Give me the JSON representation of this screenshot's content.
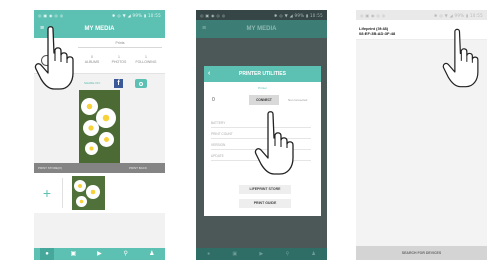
{
  "panel1": {
    "status_left": "◎ ▣ ◉ ◎ ◎",
    "status_right": "✱ ◎ ▼ ◢ 99% ▮ 10:55",
    "title": "MY MEDIA",
    "tab_label": "Prints",
    "stats": [
      "0\nALBUMS",
      "1\nPHOTOS",
      "1\nFOLLOWING"
    ],
    "social_label": "SHARE ON:",
    "print_labels": [
      "PRINT STORE(X)",
      "PRINT BACK"
    ],
    "add_label": "+",
    "nav_icons": [
      "camera-icon",
      "gallery-icon",
      "video-icon",
      "search-icon",
      "person-icon"
    ]
  },
  "panel2": {
    "status_left": "◎ ▣ ◉ ◎ ◎",
    "status_right": "✱ ◎ ▼ ◢ 99% ▮ 10:55",
    "title": "MY MEDIA",
    "dialog_title": "PRINTER UTILITIES",
    "printer_label": "Printer",
    "printer_value": "0",
    "connect_label": "CONNECT",
    "not_connected": "Not connected",
    "items": [
      "BATTERY",
      "PRINT COUNT",
      "VERSION",
      "UPDATE"
    ],
    "buttons": [
      "LIFEPRINT STORE",
      "PRINT GUIDE"
    ]
  },
  "panel3": {
    "status_left": "◎ ▣ ◉ ◎ ◎",
    "status_right": "✱ ◎ ▼ ◢ 99% ▮ 10:55",
    "device_name": "Lifeprint (3f:48)",
    "device_addr": "08:EF:3B:AD:3F:48",
    "scan_label": "SEARCH FOR DEVICES"
  }
}
